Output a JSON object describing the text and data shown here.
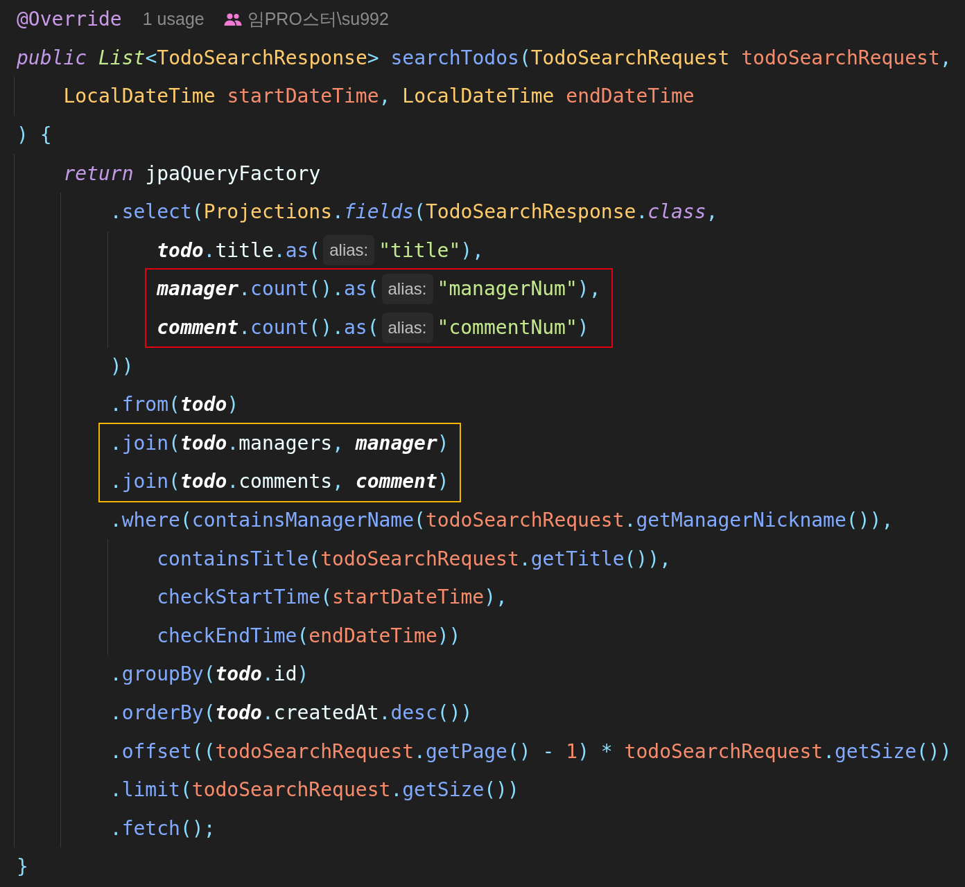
{
  "header": {
    "annotation": "@Override",
    "usages": "1 usage",
    "author": "임PRO스터\\su992"
  },
  "code": [
    {
      "kind": "line",
      "tokens": [
        {
          "kind": "kw",
          "text": "public "
        },
        {
          "kind": "type",
          "text": "List"
        },
        {
          "kind": "punc",
          "text": "<"
        },
        {
          "kind": "cls",
          "text": "TodoSearchResponse"
        },
        {
          "kind": "punc",
          "text": "> "
        },
        {
          "kind": "method",
          "text": "searchTodos"
        },
        {
          "kind": "punc",
          "text": "("
        },
        {
          "kind": "cls",
          "text": "TodoSearchRequest "
        },
        {
          "kind": "param",
          "text": "todoSearchRequest"
        },
        {
          "kind": "punc",
          "text": ","
        }
      ],
      "children": [
        {
          "kind": "line",
          "tokens": [
            {
              "kind": "cls",
              "text": "LocalDateTime "
            },
            {
              "kind": "param",
              "text": "startDateTime"
            },
            {
              "kind": "punc",
              "text": ", "
            },
            {
              "kind": "cls",
              "text": "LocalDateTime "
            },
            {
              "kind": "param",
              "text": "endDateTime"
            }
          ]
        }
      ]
    },
    {
      "kind": "line",
      "tokens": [
        {
          "kind": "punc",
          "text": ") {"
        }
      ],
      "children": [
        {
          "kind": "line",
          "tokens": [
            {
              "kind": "kw",
              "text": "return"
            },
            {
              "kind": "plain",
              "text": " jpaQueryFactory"
            }
          ],
          "children": [
            {
              "kind": "line",
              "tokens": [
                {
                  "kind": "punc",
                  "text": "."
                },
                {
                  "kind": "method",
                  "text": "select"
                },
                {
                  "kind": "punc",
                  "text": "("
                },
                {
                  "kind": "cls",
                  "text": "Projections"
                },
                {
                  "kind": "punc",
                  "text": "."
                },
                {
                  "kind": "imethod",
                  "text": "fields"
                },
                {
                  "kind": "punc",
                  "text": "("
                },
                {
                  "kind": "cls",
                  "text": "TodoSearchResponse"
                },
                {
                  "kind": "punc",
                  "text": "."
                },
                {
                  "kind": "kw",
                  "text": "class"
                },
                {
                  "kind": "punc",
                  "text": ","
                }
              ],
              "children": [
                {
                  "kind": "line",
                  "tokens": [
                    {
                      "kind": "static",
                      "text": "todo"
                    },
                    {
                      "kind": "punc",
                      "text": "."
                    },
                    {
                      "kind": "field",
                      "text": "title"
                    },
                    {
                      "kind": "punc",
                      "text": "."
                    },
                    {
                      "kind": "method",
                      "text": "as"
                    },
                    {
                      "kind": "punc",
                      "text": "("
                    },
                    {
                      "kind": "hint",
                      "text": "alias:"
                    },
                    {
                      "kind": "str",
                      "text": "\"title\""
                    },
                    {
                      "kind": "punc",
                      "text": "),"
                    }
                  ]
                },
                {
                  "kind": "box",
                  "color": "#e6000f",
                  "lines": [
                    {
                      "kind": "line",
                      "tokens": [
                        {
                          "kind": "static",
                          "text": "manager"
                        },
                        {
                          "kind": "punc",
                          "text": "."
                        },
                        {
                          "kind": "method",
                          "text": "count"
                        },
                        {
                          "kind": "punc",
                          "text": "()."
                        },
                        {
                          "kind": "method",
                          "text": "as"
                        },
                        {
                          "kind": "punc",
                          "text": "("
                        },
                        {
                          "kind": "hint",
                          "text": "alias:"
                        },
                        {
                          "kind": "str",
                          "text": "\"managerNum\""
                        },
                        {
                          "kind": "punc",
                          "text": "),"
                        }
                      ]
                    },
                    {
                      "kind": "line",
                      "tokens": [
                        {
                          "kind": "static",
                          "text": "comment"
                        },
                        {
                          "kind": "punc",
                          "text": "."
                        },
                        {
                          "kind": "method",
                          "text": "count"
                        },
                        {
                          "kind": "punc",
                          "text": "()."
                        },
                        {
                          "kind": "method",
                          "text": "as"
                        },
                        {
                          "kind": "punc",
                          "text": "("
                        },
                        {
                          "kind": "hint",
                          "text": "alias:"
                        },
                        {
                          "kind": "str",
                          "text": "\"commentNum\""
                        },
                        {
                          "kind": "punc",
                          "text": ")"
                        }
                      ]
                    }
                  ]
                }
              ]
            },
            {
              "kind": "line",
              "tokens": [
                {
                  "kind": "punc",
                  "text": "))"
                }
              ]
            },
            {
              "kind": "line",
              "tokens": [
                {
                  "kind": "punc",
                  "text": "."
                },
                {
                  "kind": "method",
                  "text": "from"
                },
                {
                  "kind": "punc",
                  "text": "("
                },
                {
                  "kind": "static",
                  "text": "todo"
                },
                {
                  "kind": "punc",
                  "text": ")"
                }
              ]
            },
            {
              "kind": "box",
              "color": "#f5b400",
              "lines": [
                {
                  "kind": "line",
                  "tokens": [
                    {
                      "kind": "punc",
                      "text": "."
                    },
                    {
                      "kind": "method",
                      "text": "join"
                    },
                    {
                      "kind": "punc",
                      "text": "("
                    },
                    {
                      "kind": "static",
                      "text": "todo"
                    },
                    {
                      "kind": "punc",
                      "text": "."
                    },
                    {
                      "kind": "field",
                      "text": "managers"
                    },
                    {
                      "kind": "punc",
                      "text": ", "
                    },
                    {
                      "kind": "static",
                      "text": "manager"
                    },
                    {
                      "kind": "punc",
                      "text": ")"
                    }
                  ]
                },
                {
                  "kind": "line",
                  "tokens": [
                    {
                      "kind": "punc",
                      "text": "."
                    },
                    {
                      "kind": "method",
                      "text": "join"
                    },
                    {
                      "kind": "punc",
                      "text": "("
                    },
                    {
                      "kind": "static",
                      "text": "todo"
                    },
                    {
                      "kind": "punc",
                      "text": "."
                    },
                    {
                      "kind": "field",
                      "text": "comments"
                    },
                    {
                      "kind": "punc",
                      "text": ", "
                    },
                    {
                      "kind": "static",
                      "text": "comment"
                    },
                    {
                      "kind": "punc",
                      "text": ")"
                    }
                  ]
                }
              ]
            },
            {
              "kind": "line",
              "tokens": [
                {
                  "kind": "punc",
                  "text": "."
                },
                {
                  "kind": "method",
                  "text": "where"
                },
                {
                  "kind": "punc",
                  "text": "("
                },
                {
                  "kind": "method",
                  "text": "containsManagerName"
                },
                {
                  "kind": "punc",
                  "text": "("
                },
                {
                  "kind": "param",
                  "text": "todoSearchRequest"
                },
                {
                  "kind": "punc",
                  "text": "."
                },
                {
                  "kind": "method",
                  "text": "getManagerNickname"
                },
                {
                  "kind": "punc",
                  "text": "()),"
                }
              ],
              "children": [
                {
                  "kind": "line",
                  "tokens": [
                    {
                      "kind": "method",
                      "text": "containsTitle"
                    },
                    {
                      "kind": "punc",
                      "text": "("
                    },
                    {
                      "kind": "param",
                      "text": "todoSearchRequest"
                    },
                    {
                      "kind": "punc",
                      "text": "."
                    },
                    {
                      "kind": "method",
                      "text": "getTitle"
                    },
                    {
                      "kind": "punc",
                      "text": "()),"
                    }
                  ]
                },
                {
                  "kind": "line",
                  "tokens": [
                    {
                      "kind": "method",
                      "text": "checkStartTime"
                    },
                    {
                      "kind": "punc",
                      "text": "("
                    },
                    {
                      "kind": "param",
                      "text": "startDateTime"
                    },
                    {
                      "kind": "punc",
                      "text": "),"
                    }
                  ]
                },
                {
                  "kind": "line",
                  "tokens": [
                    {
                      "kind": "method",
                      "text": "checkEndTime"
                    },
                    {
                      "kind": "punc",
                      "text": "("
                    },
                    {
                      "kind": "param",
                      "text": "endDateTime"
                    },
                    {
                      "kind": "punc",
                      "text": "))"
                    }
                  ]
                }
              ]
            },
            {
              "kind": "line",
              "tokens": [
                {
                  "kind": "punc",
                  "text": "."
                },
                {
                  "kind": "method",
                  "text": "groupBy"
                },
                {
                  "kind": "punc",
                  "text": "("
                },
                {
                  "kind": "static",
                  "text": "todo"
                },
                {
                  "kind": "punc",
                  "text": "."
                },
                {
                  "kind": "field",
                  "text": "id"
                },
                {
                  "kind": "punc",
                  "text": ")"
                }
              ]
            },
            {
              "kind": "line",
              "tokens": [
                {
                  "kind": "punc",
                  "text": "."
                },
                {
                  "kind": "method",
                  "text": "orderBy"
                },
                {
                  "kind": "punc",
                  "text": "("
                },
                {
                  "kind": "static",
                  "text": "todo"
                },
                {
                  "kind": "punc",
                  "text": "."
                },
                {
                  "kind": "field",
                  "text": "createdAt"
                },
                {
                  "kind": "punc",
                  "text": "."
                },
                {
                  "kind": "method",
                  "text": "desc"
                },
                {
                  "kind": "punc",
                  "text": "())"
                }
              ]
            },
            {
              "kind": "line",
              "tokens": [
                {
                  "kind": "punc",
                  "text": "."
                },
                {
                  "kind": "method",
                  "text": "offset"
                },
                {
                  "kind": "punc",
                  "text": "(("
                },
                {
                  "kind": "param",
                  "text": "todoSearchRequest"
                },
                {
                  "kind": "punc",
                  "text": "."
                },
                {
                  "kind": "method",
                  "text": "getPage"
                },
                {
                  "kind": "punc",
                  "text": "() - "
                },
                {
                  "kind": "num",
                  "text": "1"
                },
                {
                  "kind": "punc",
                  "text": ") * "
                },
                {
                  "kind": "param",
                  "text": "todoSearchRequest"
                },
                {
                  "kind": "punc",
                  "text": "."
                },
                {
                  "kind": "method",
                  "text": "getSize"
                },
                {
                  "kind": "punc",
                  "text": "())"
                }
              ]
            },
            {
              "kind": "line",
              "tokens": [
                {
                  "kind": "punc",
                  "text": "."
                },
                {
                  "kind": "method",
                  "text": "limit"
                },
                {
                  "kind": "punc",
                  "text": "("
                },
                {
                  "kind": "param",
                  "text": "todoSearchRequest"
                },
                {
                  "kind": "punc",
                  "text": "."
                },
                {
                  "kind": "method",
                  "text": "getSize"
                },
                {
                  "kind": "punc",
                  "text": "())"
                }
              ]
            },
            {
              "kind": "line",
              "tokens": [
                {
                  "kind": "punc",
                  "text": "."
                },
                {
                  "kind": "method",
                  "text": "fetch"
                },
                {
                  "kind": "punc",
                  "text": "();"
                }
              ]
            }
          ]
        }
      ]
    },
    {
      "kind": "line",
      "tokens": [
        {
          "kind": "punc",
          "text": "}"
        }
      ]
    }
  ]
}
